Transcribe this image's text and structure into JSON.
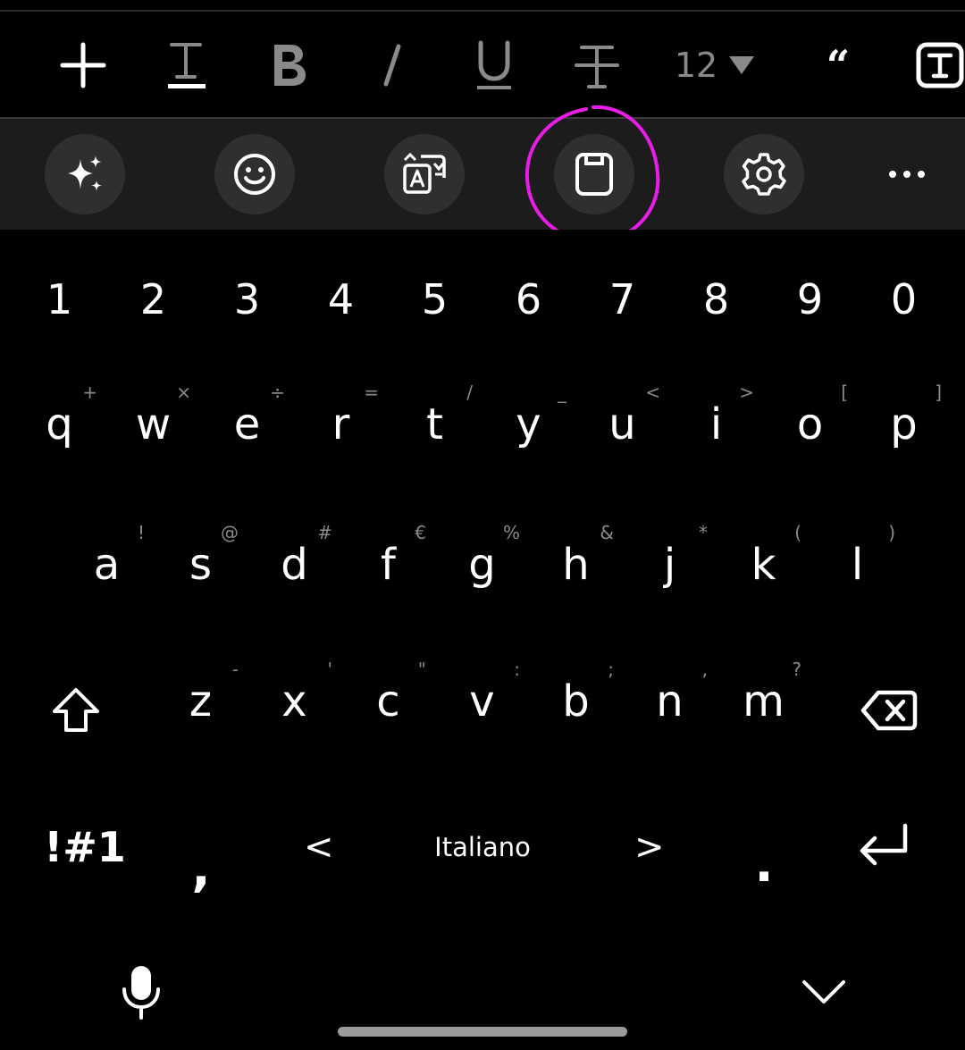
{
  "format_toolbar": {
    "font_size": "12",
    "quote_glyph": "“"
  },
  "keyboard": {
    "number_row": [
      "1",
      "2",
      "3",
      "4",
      "5",
      "6",
      "7",
      "8",
      "9",
      "0"
    ],
    "row1": [
      {
        "key": "q",
        "hint": "+"
      },
      {
        "key": "w",
        "hint": "×"
      },
      {
        "key": "e",
        "hint": "÷"
      },
      {
        "key": "r",
        "hint": "="
      },
      {
        "key": "t",
        "hint": "/"
      },
      {
        "key": "y",
        "hint": "_"
      },
      {
        "key": "u",
        "hint": "<"
      },
      {
        "key": "i",
        "hint": ">"
      },
      {
        "key": "o",
        "hint": "["
      },
      {
        "key": "p",
        "hint": "]"
      }
    ],
    "row2": [
      {
        "key": "a",
        "hint": "!"
      },
      {
        "key": "s",
        "hint": "@"
      },
      {
        "key": "d",
        "hint": "#"
      },
      {
        "key": "f",
        "hint": "€"
      },
      {
        "key": "g",
        "hint": "%"
      },
      {
        "key": "h",
        "hint": "&"
      },
      {
        "key": "j",
        "hint": "*"
      },
      {
        "key": "k",
        "hint": "("
      },
      {
        "key": "l",
        "hint": ")"
      }
    ],
    "row3": [
      {
        "key": "z",
        "hint": "-"
      },
      {
        "key": "x",
        "hint": "'"
      },
      {
        "key": "c",
        "hint": "\""
      },
      {
        "key": "v",
        "hint": ":"
      },
      {
        "key": "b",
        "hint": ";"
      },
      {
        "key": "n",
        "hint": ","
      },
      {
        "key": "m",
        "hint": "?"
      }
    ],
    "symbols_label": "!#1",
    "comma": ",",
    "period": ".",
    "space_prev": "<",
    "space_next": ">",
    "space_label": "Italiano"
  },
  "colors": {
    "highlight_circle": "#e81ee8",
    "toolbar_bg": "#1c1c1c",
    "tool_button_bg": "#2f2f2f"
  }
}
